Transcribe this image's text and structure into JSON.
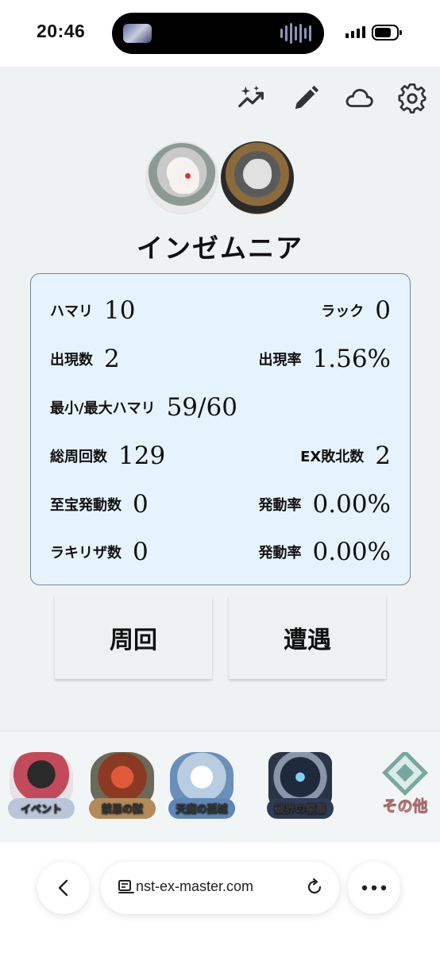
{
  "status_bar": {
    "time": "20:46"
  },
  "toolbar": {
    "icons": [
      "sparkle-chart-icon",
      "pencil-icon",
      "cloud-icon",
      "gear-icon"
    ]
  },
  "character": {
    "name": "インゼムニア"
  },
  "stats": {
    "hamari_label": "ハマリ",
    "hamari_value": "10",
    "luck_label": "ラック",
    "luck_value": "0",
    "appear_count_label": "出現数",
    "appear_count_value": "2",
    "appear_rate_label": "出現率",
    "appear_rate_value": "1.56%",
    "minmax_label": "最小/最大ハマリ",
    "minmax_value": "59/60",
    "total_runs_label": "総周回数",
    "total_runs_value": "129",
    "ex_defeat_label": "EX敗北数",
    "ex_defeat_value": "2",
    "treasure_label": "至宝発動数",
    "treasure_value": "0",
    "treasure_rate_label": "発動率",
    "treasure_rate_value": "0.00%",
    "rakiriza_label": "ラキリザ数",
    "rakiriza_value": "0",
    "rakiriza_rate_label": "発動率",
    "rakiriza_rate_value": "0.00%"
  },
  "actions": {
    "run_label": "周回",
    "encounter_label": "遭遇"
  },
  "bottom_nav": {
    "items": [
      {
        "label": "イベント",
        "color": "#c24a5a"
      },
      {
        "label": "禁忌の獄",
        "color": "#b0452a"
      },
      {
        "label": "天魔の孤城",
        "color": "#6a8fb8"
      },
      {
        "label": "破界の星墓",
        "color": "#34415a"
      },
      {
        "label": "その他",
        "color": "#7aa6a0"
      }
    ]
  },
  "browser": {
    "url": "nst-ex-master.com"
  }
}
